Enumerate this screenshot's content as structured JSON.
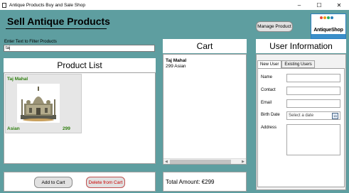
{
  "window": {
    "title": "Antique Products Buy and Sale Shop",
    "controls": {
      "minimize": "–",
      "maximize": "☐",
      "close": "✕"
    }
  },
  "header": {
    "heading": "Sell Antique Products",
    "manage_button": "Manage Product",
    "logo_text": "AntiqueShop",
    "logo_colors": [
      "#e74c3c",
      "#f39c12",
      "#27ae60",
      "#2980b9"
    ]
  },
  "filter": {
    "label": "Enter Text to Filter Products",
    "value": "taj"
  },
  "product_list": {
    "title": "Product List",
    "products": [
      {
        "name": "Taj Mahal",
        "category": "Asian",
        "price": "299",
        "image_icon": "taj-mahal-image"
      }
    ]
  },
  "actions": {
    "add_to_cart": "Add to Cart",
    "delete_from_cart": "Delete from Cart"
  },
  "cart": {
    "title": "Cart",
    "items": [
      {
        "name": "Taj Mahal",
        "detail": "299 Asian"
      }
    ],
    "total": "Total Amount: €299"
  },
  "user_info": {
    "title": "User Information",
    "tabs": [
      "New User",
      "Existing Users"
    ],
    "active_tab": "New User",
    "fields": {
      "name": "Name",
      "contact": "Contact",
      "email": "Email",
      "birth_date": "Birth Date",
      "address": "Address"
    },
    "date_placeholder": "Select a date",
    "calendar_label": "15"
  }
}
